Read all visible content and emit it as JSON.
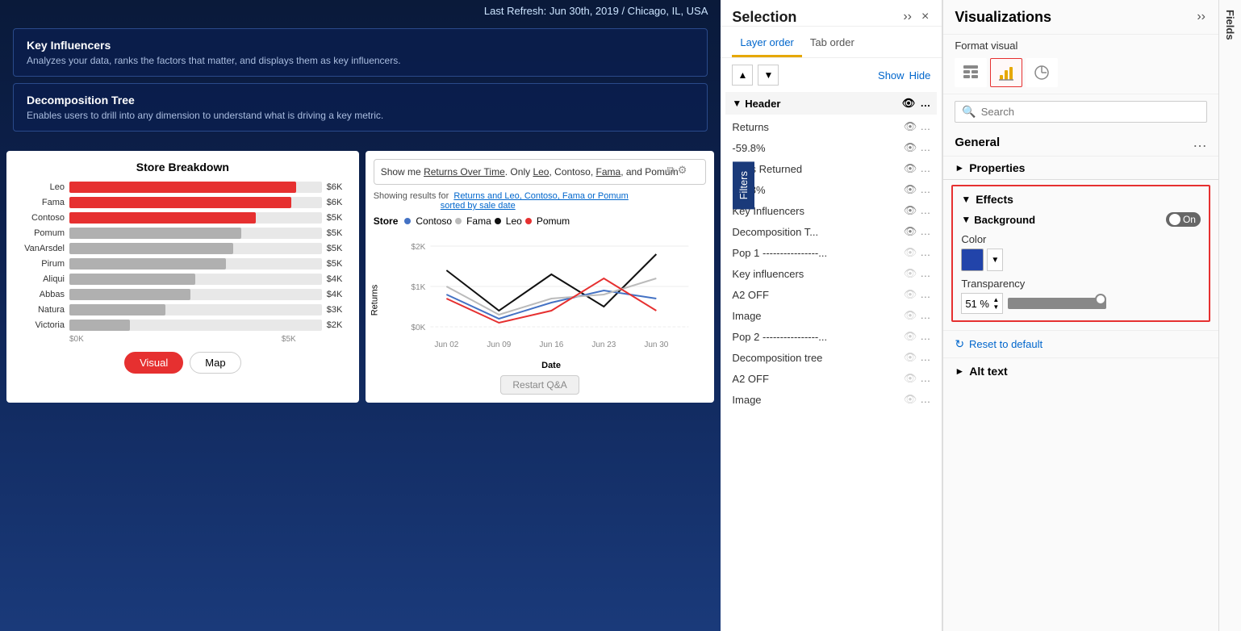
{
  "header": {
    "refresh": "Last Refresh: Jun 30th, 2019 / Chicago, IL, USA"
  },
  "visual_cards": [
    {
      "title": "Key Influencers",
      "desc": "Analyzes your data, ranks the factors that matter, and displays them as key influencers."
    },
    {
      "title": "Decomposition Tree",
      "desc": "Enables users to drill into any dimension to understand what is driving a key metric."
    }
  ],
  "store_breakdown": {
    "title": "Store Breakdown",
    "bars": [
      {
        "label": "Leo",
        "value": "$6K",
        "pct": 90,
        "red": true
      },
      {
        "label": "Fama",
        "value": "$6K",
        "pct": 88,
        "red": true
      },
      {
        "label": "Contoso",
        "value": "$5K",
        "pct": 74,
        "red": true
      },
      {
        "label": "Pomum",
        "value": "$5K",
        "pct": 68,
        "red": false
      },
      {
        "label": "VanArsdel",
        "value": "$5K",
        "pct": 65,
        "red": false
      },
      {
        "label": "Pirum",
        "value": "$5K",
        "pct": 62,
        "red": false
      },
      {
        "label": "Aliqui",
        "value": "$4K",
        "pct": 50,
        "red": false
      },
      {
        "label": "Abbas",
        "value": "$4K",
        "pct": 48,
        "red": false
      },
      {
        "label": "Natura",
        "value": "$3K",
        "pct": 38,
        "red": false
      },
      {
        "label": "Victoria",
        "value": "$2K",
        "pct": 24,
        "red": false
      }
    ],
    "xaxis": [
      "$0K",
      "$5K"
    ],
    "tabs": [
      "Visual",
      "Map"
    ]
  },
  "qa_card": {
    "prompt": "Show me Returns Over Time. Only Leo, Contoso, Fama, and Pomum",
    "showing_label": "Showing results for",
    "showing_link": "Returns and Leo, Contoso, Fama or Pomum",
    "showing_link2": "sorted by sale date",
    "legend": [
      {
        "name": "Contoso",
        "color": "#4472C4"
      },
      {
        "name": "Fama",
        "color": "#aaaaaa"
      },
      {
        "name": "Leo",
        "color": "#222222"
      },
      {
        "name": "Pomum",
        "color": "#e63030"
      }
    ],
    "store_label": "Store",
    "y_label": "Returns",
    "x_label": "Date",
    "x_ticks": [
      "Jun 02",
      "Jun 09",
      "Jun 16",
      "Jun 23",
      "Jun 30"
    ],
    "y_ticks": [
      "$2K",
      "$1K",
      "$0K"
    ],
    "restart_btn": "Restart Q&A"
  },
  "selection": {
    "title": "Selection",
    "collapse_label": ">>",
    "close_label": "×",
    "tabs": [
      "Layer order",
      "Tab order"
    ],
    "active_tab": "Layer order",
    "show_label": "Show",
    "hide_label": "Hide",
    "header_section": "Header",
    "layers": [
      {
        "name": "Returns",
        "visible": true,
        "indent": false
      },
      {
        "name": "-59.8%",
        "visible": true,
        "indent": false
      },
      {
        "name": "Units Returned",
        "visible": true,
        "indent": false
      },
      {
        "name": "-59.8%",
        "visible": true,
        "indent": false
      },
      {
        "name": "Key Influencers",
        "visible": true,
        "indent": false
      },
      {
        "name": "Decomposition T...",
        "visible": true,
        "indent": false
      },
      {
        "name": "Pop 1 ----------------...",
        "visible": false,
        "indent": false
      },
      {
        "name": "Key influencers",
        "visible": false,
        "indent": false
      },
      {
        "name": "A2 OFF",
        "visible": false,
        "indent": false
      },
      {
        "name": "Image",
        "visible": false,
        "indent": false
      },
      {
        "name": "Pop 2 ----------------...",
        "visible": false,
        "indent": false
      },
      {
        "name": "Decomposition tree",
        "visible": false,
        "indent": false
      },
      {
        "name": "A2 OFF",
        "visible": false,
        "indent": false
      },
      {
        "name": "Image",
        "visible": false,
        "indent": false
      }
    ]
  },
  "filters_label": "Filters",
  "visualizations": {
    "title": "Visualizations",
    "expand_label": ">>",
    "format_visual": "Format visual",
    "search_placeholder": "Search",
    "general_label": "General",
    "general_dots": "...",
    "properties_label": "Properties",
    "effects_label": "Effects",
    "background_label": "Background",
    "toggle_state": "On",
    "color_label": "Color",
    "transparency_label": "Transparency",
    "transparency_value": "51 %",
    "reset_label": "Reset to default",
    "alt_text_label": "Alt text"
  },
  "fields_label": "Fields"
}
